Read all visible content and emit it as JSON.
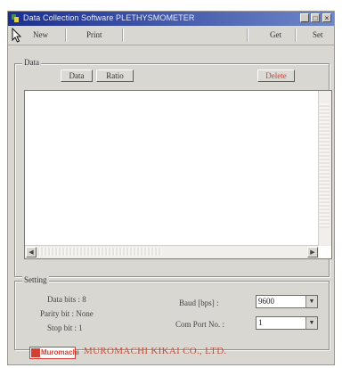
{
  "window": {
    "title": "Data Collection Software PLETHYSMOMETER",
    "controls": [
      "_",
      "□",
      "×"
    ]
  },
  "menubar": {
    "left_items": [
      "New",
      "Print"
    ],
    "right_items": [
      "Get",
      "Set"
    ]
  },
  "data_group": {
    "label": "Data",
    "buttons": {
      "data": "Data",
      "ratio": "Ratio",
      "delete": "Delete"
    }
  },
  "setting_group": {
    "label": "Setting",
    "left_lines": [
      "Data bits : 8",
      "Parity bit : None",
      "Stop bit : 1"
    ],
    "baud_label": "Baud [bps] :",
    "baud_value": "9600",
    "port_label": "Com Port No. :",
    "port_value": "1"
  },
  "footer": {
    "logo": "Muromachi",
    "company": "MUROMACHI KIKAI CO., LTD."
  },
  "colors": {
    "title_start": "#1b2f8f",
    "title_end": "#6f86c9",
    "brand_red": "#d24034"
  }
}
